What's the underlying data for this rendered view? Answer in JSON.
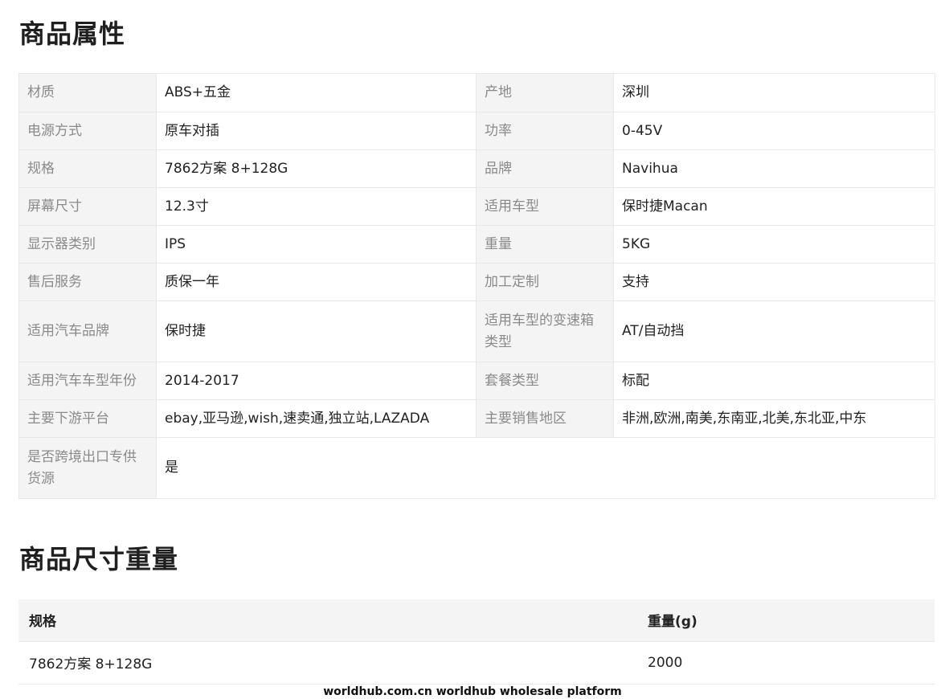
{
  "sections": {
    "attributes_title": "商品属性",
    "size_weight_title": "商品尺寸重量"
  },
  "attributes": [
    {
      "k1": "材质",
      "v1": "ABS+五金",
      "k2": "产地",
      "v2": "深圳"
    },
    {
      "k1": "电源方式",
      "v1": "原车对插",
      "k2": "功率",
      "v2": "0-45V"
    },
    {
      "k1": "规格",
      "v1": "7862方案 8+128G",
      "k2": "品牌",
      "v2": "Navihua"
    },
    {
      "k1": "屏幕尺寸",
      "v1": "12.3寸",
      "k2": "适用车型",
      "v2": "保时捷Macan"
    },
    {
      "k1": "显示器类别",
      "v1": "IPS",
      "k2": "重量",
      "v2": "5KG"
    },
    {
      "k1": "售后服务",
      "v1": "质保一年",
      "k2": "加工定制",
      "v2": "支持"
    },
    {
      "k1": "适用汽车品牌",
      "v1": "保时捷",
      "k2": "适用车型的变速箱类型",
      "v2": "AT/自动挡"
    },
    {
      "k1": "适用汽车车型年份",
      "v1": "2014-2017",
      "k2": "套餐类型",
      "v2": "标配"
    },
    {
      "k1": "主要下游平台",
      "v1": "ebay,亚马逊,wish,速卖通,独立站,LAZADA",
      "k2": "主要销售地区",
      "v2": "非洲,欧洲,南美,东南亚,北美,东北亚,中东"
    },
    {
      "k1": "是否跨境出口专供货源",
      "v1": "是"
    }
  ],
  "size_table": {
    "headers": [
      "规格",
      "重量(g)"
    ],
    "rows": [
      [
        "7862方案 8+128G",
        "2000"
      ]
    ]
  },
  "footer": "worldhub.com.cn worldhub wholesale platform"
}
